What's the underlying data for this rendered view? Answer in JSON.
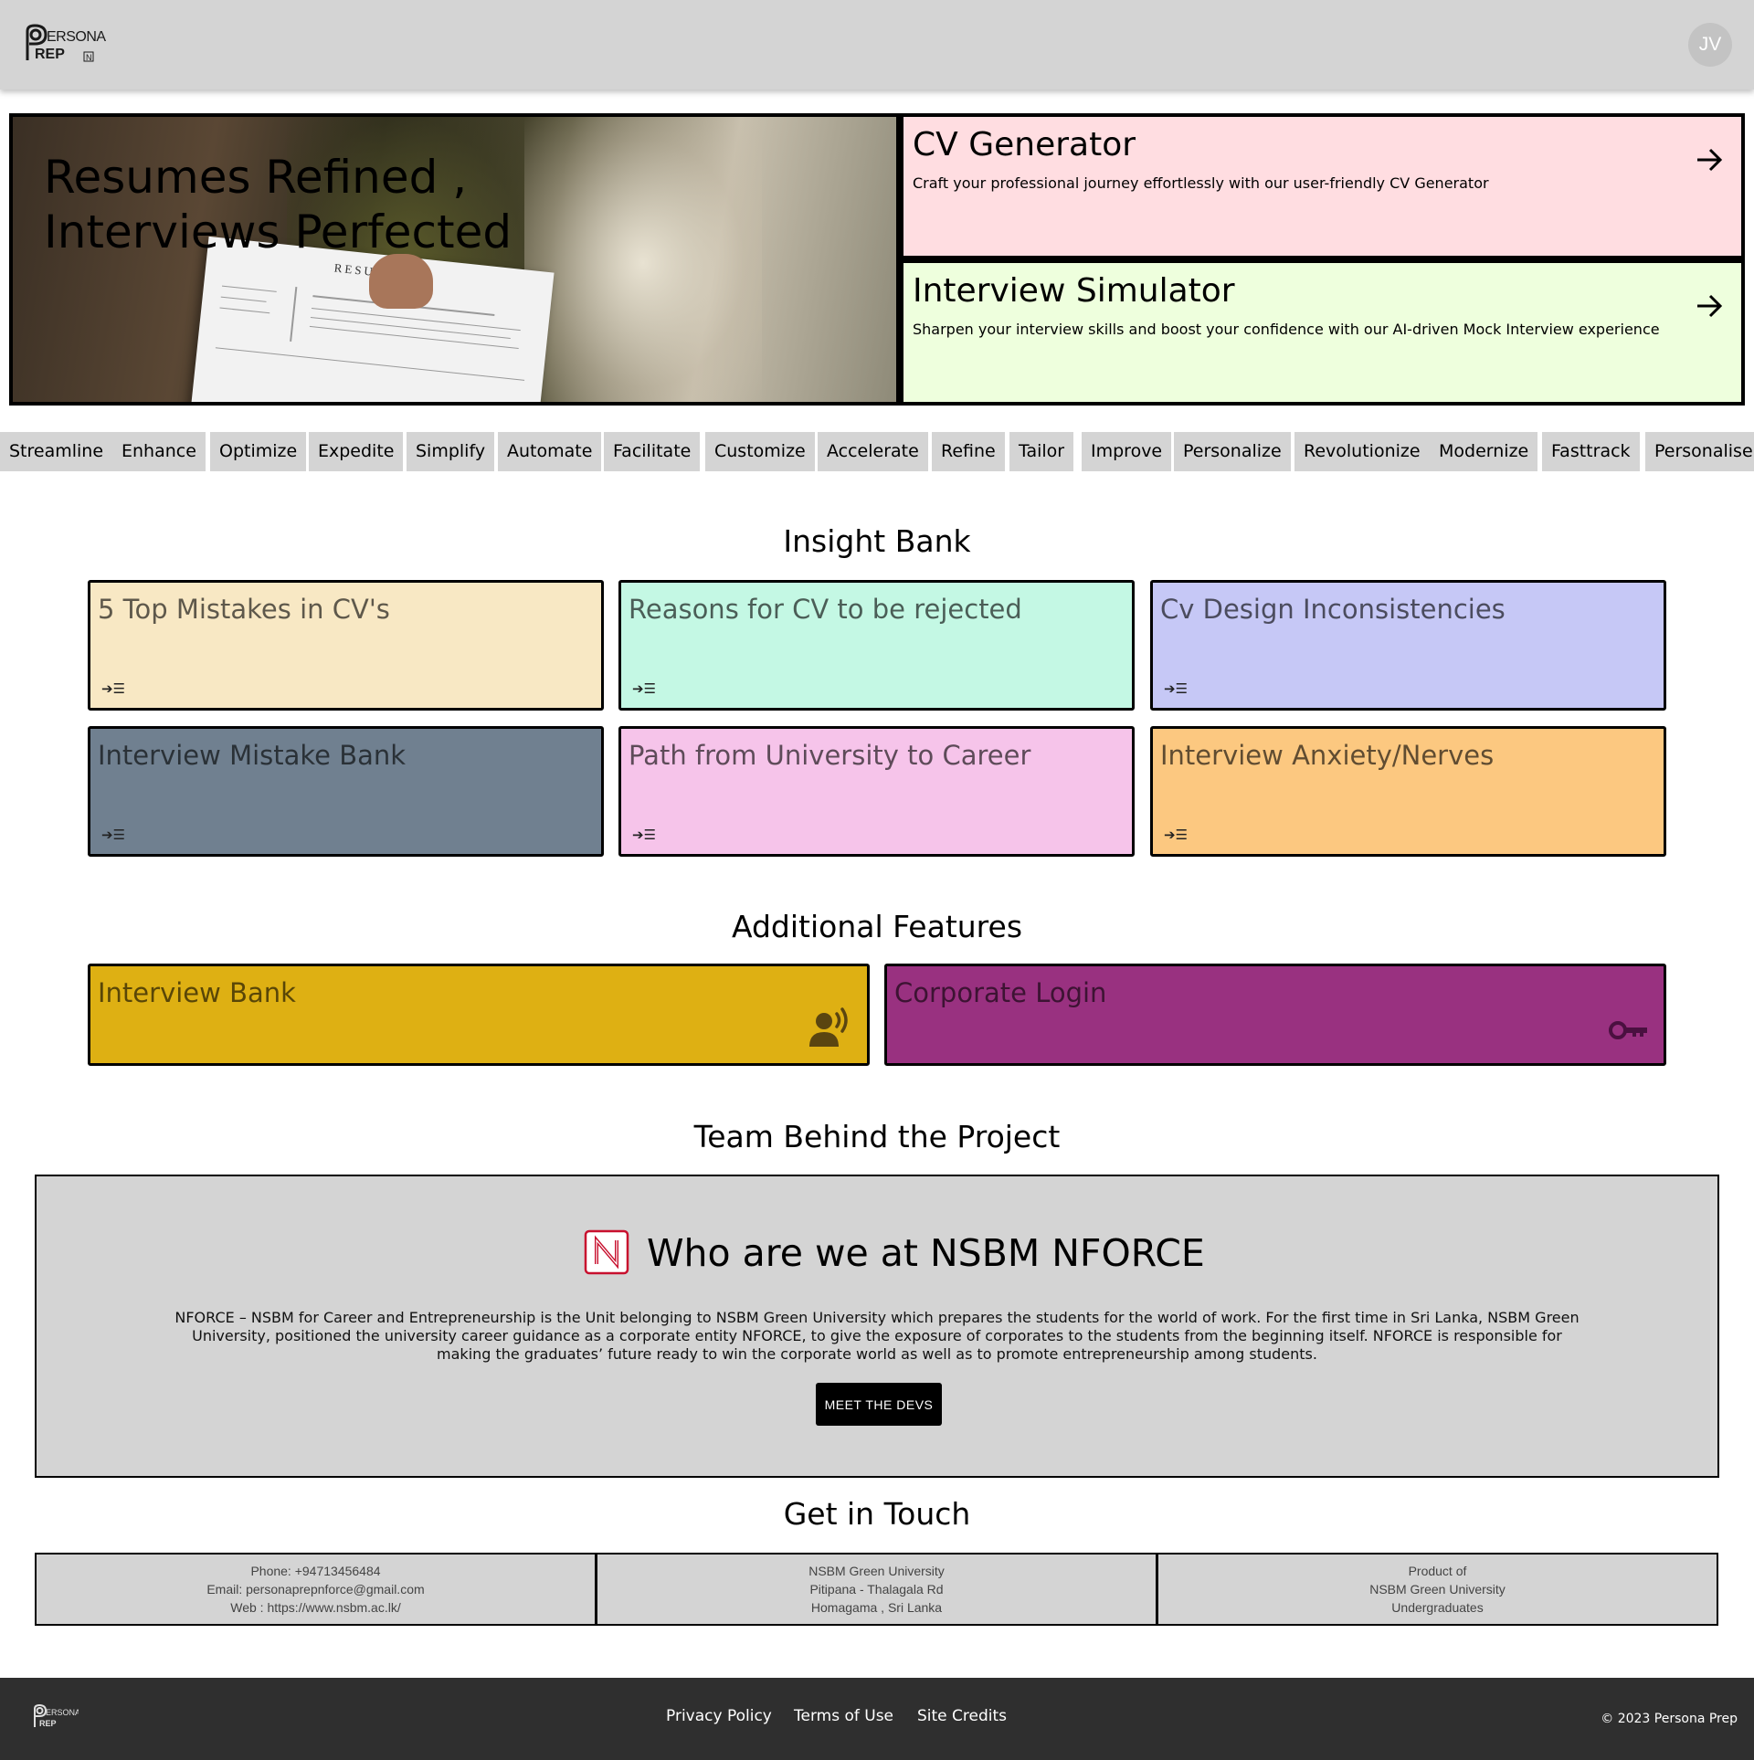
{
  "header": {
    "logo_text": "PERSONA PREP",
    "avatar_initials": "JV"
  },
  "hero": {
    "title_line1": "Resumes Refined ,",
    "title_line2": "Interviews Perfected",
    "paper_heading": "RESUME"
  },
  "features": [
    {
      "title": "CV Generator",
      "desc": "Craft your professional journey effortlessly with our user-friendly CV Generator",
      "color": "#ffdde1",
      "icon": "arrow-right-icon"
    },
    {
      "title": "Interview Simulator",
      "desc": "Sharpen your interview skills and boost your confidence with our AI-driven Mock Interview experience",
      "color": "#eeffdd",
      "icon": "arrow-right-icon"
    }
  ],
  "ticker": [
    "Streamline",
    "Enhance",
    "Optimize",
    "Expedite",
    "Simplify",
    "Automate",
    "Facilitate",
    "Customize",
    "Accelerate",
    "Refine",
    "Tailor",
    "Improve",
    "Personalize",
    "Revolutionize",
    "Modernize",
    "Fasttrack",
    "Personalise"
  ],
  "insight": {
    "title": "Insight Bank",
    "cards": [
      {
        "title": "5 Top Mistakes in CV's",
        "color": "#f8e8c4",
        "icon": "expand-list-icon"
      },
      {
        "title": "Reasons for CV to be rejected",
        "color": "#c4f8e4",
        "icon": "expand-list-icon"
      },
      {
        "title": "Cv Design Inconsistencies",
        "color": "#c6c8f6",
        "icon": "expand-list-icon"
      },
      {
        "title": "Interview Mistake Bank",
        "color": "#708090",
        "icon": "expand-list-icon"
      },
      {
        "title": "Path from University to Career",
        "color": "#f6c4ea",
        "icon": "expand-list-icon"
      },
      {
        "title": "Interview Anxiety/Nerves",
        "color": "#fcc880",
        "icon": "expand-list-icon"
      }
    ]
  },
  "additional": {
    "title": "Additional Features",
    "cards": [
      {
        "title": "Interview Bank",
        "color": "#deb013",
        "icon": "speaking-person-icon"
      },
      {
        "title": "Corporate Login",
        "color": "#993180",
        "icon": "key-icon"
      }
    ]
  },
  "team": {
    "title": "Team Behind the Project",
    "heading": "Who are we at NSBM NFORCE",
    "logo_letter": "N",
    "paragraph": "NFORCE – NSBM for Career and Entrepreneurship is the Unit belonging to NSBM Green University which prepares the students for the world of work. For the first time in Sri Lanka, NSBM Green University, positioned the university career guidance as a corporate entity NFORCE, to give the exposure of corporates to the students from the beginning itself. NFORCE is responsible for making the graduates’ future ready to win the corporate world as well as to promote entrepreneurship among students.",
    "button": "MEET THE DEVS"
  },
  "contact": {
    "title": "Get in Touch",
    "boxes": [
      [
        "Phone: +94713456484",
        "Email: personaprepnforce@gmail.com",
        "Web : https://www.nsbm.ac.lk/"
      ],
      [
        "NSBM Green University",
        "Pitipana - Thalagala Rd",
        "Homagama , Sri Lanka"
      ],
      [
        "Product of",
        "NSBM Green University",
        "Undergraduates"
      ]
    ]
  },
  "footer": {
    "links": [
      "Privacy Policy",
      "Terms of Use",
      "Site Credits"
    ],
    "copyright": "© 2023 Persona Prep"
  }
}
